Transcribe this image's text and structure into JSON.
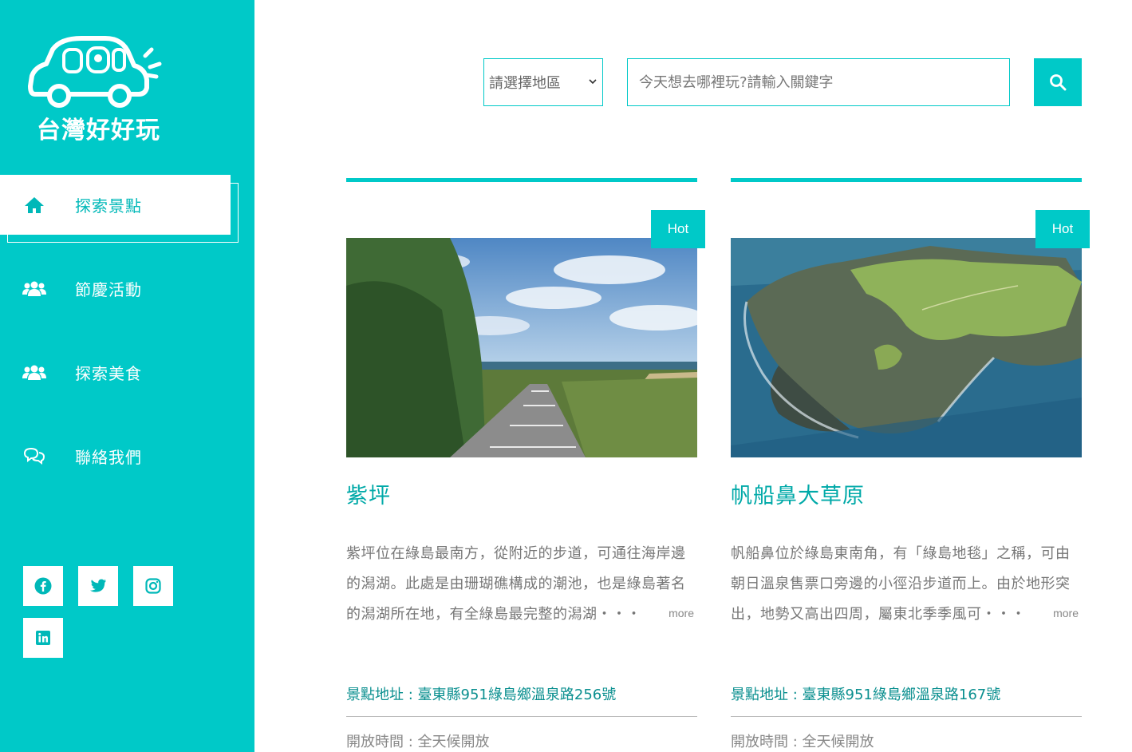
{
  "brand": {
    "logo_text": "台灣好好玩",
    "accent_color": "#00c9c8"
  },
  "nav": {
    "items": [
      {
        "label": "探索景點",
        "icon": "home-icon",
        "active": true
      },
      {
        "label": "節慶活動",
        "icon": "users-icon",
        "active": false
      },
      {
        "label": "探索美食",
        "icon": "users-icon",
        "active": false
      },
      {
        "label": "聯絡我們",
        "icon": "chat-icon",
        "active": false
      }
    ]
  },
  "social": [
    "facebook-icon",
    "twitter-icon",
    "instagram-icon",
    "linkedin-icon"
  ],
  "search": {
    "region_selected": "請選擇地區",
    "placeholder": "今天想去哪裡玩?請輸入關鍵字"
  },
  "cards": [
    {
      "badge": "Hot",
      "title": "紫坪",
      "description": "紫坪位在綠島最南方，從附近的步道，可通往海岸邊的潟湖。此處是由珊瑚礁構成的潮池，也是綠島著名的潟湖所在地，有全綠島最完整的潟湖・・・",
      "more": "more",
      "address": "景點地址 : 臺東縣951綠島鄉溫泉路256號",
      "hours": "開放時間 : 全天候開放"
    },
    {
      "badge": "Hot",
      "title": "帆船鼻大草原",
      "description": "帆船鼻位於綠島東南角，有「綠島地毯」之稱，可由朝日溫泉售票口旁邊的小徑沿步道而上。由於地形突出，地勢又高出四周，屬東北季季風可・・・",
      "more": "more",
      "address": "景點地址 : 臺東縣951綠島鄉溫泉路167號",
      "hours": "開放時間 : 全天候開放"
    }
  ]
}
